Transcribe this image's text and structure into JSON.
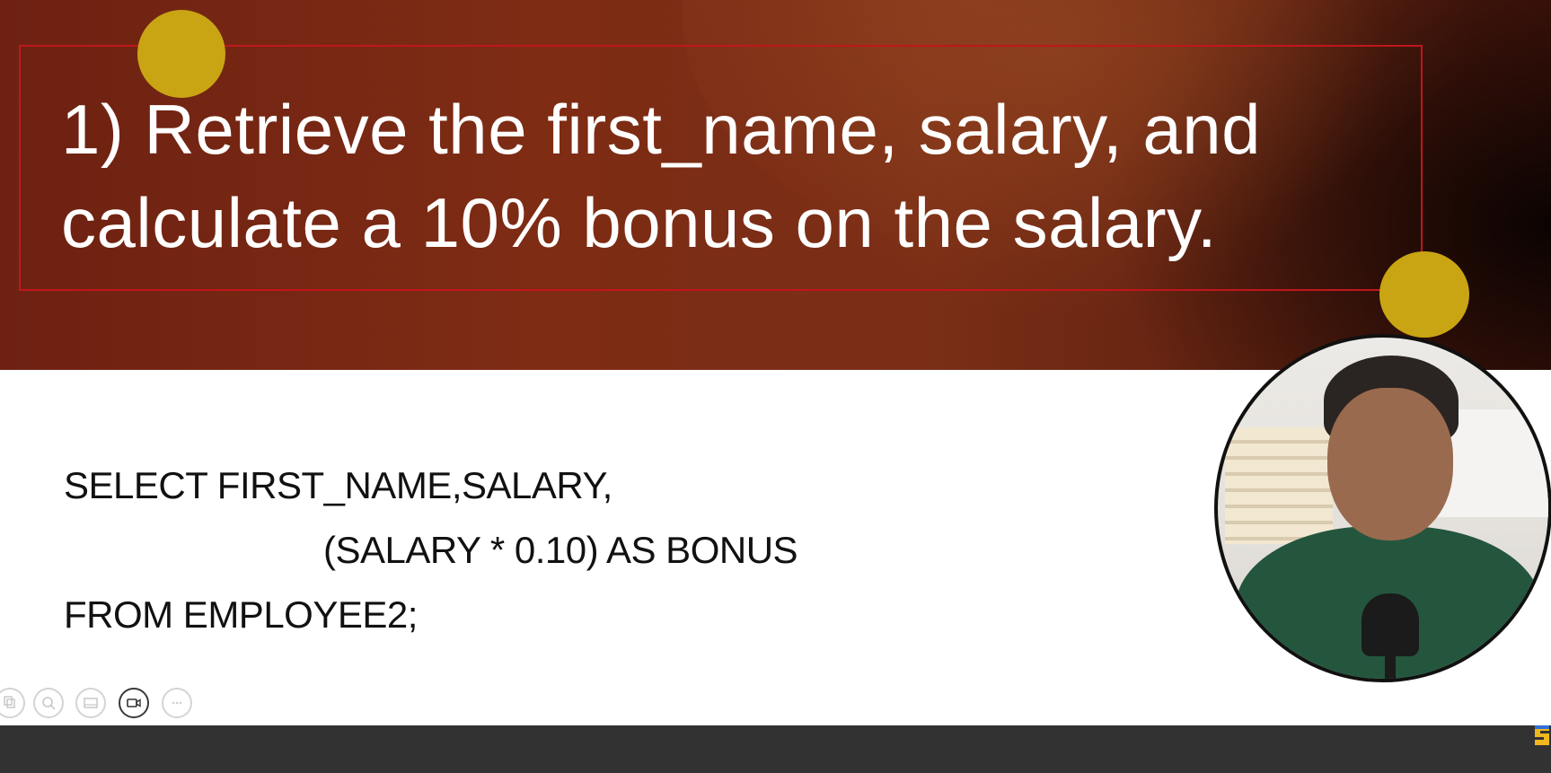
{
  "slide": {
    "title_lines": [
      "1) Retrieve the first_name, salary, and",
      "calculate a 10% bonus on the salary."
    ],
    "code_lines": [
      "SELECT FIRST_NAME,SALARY,",
      "(SALARY * 0.10) AS BONUS",
      "FROM EMPLOYEE2;"
    ]
  },
  "toolbar": {
    "items": [
      {
        "icon": "copy-icon"
      },
      {
        "icon": "zoom-icon"
      },
      {
        "icon": "slides-icon"
      },
      {
        "icon": "video-icon"
      },
      {
        "icon": "more-icon"
      }
    ]
  },
  "colors": {
    "banner_red": "#7e2c14",
    "frame_red": "#c0161c",
    "dot_yellow": "#c9a514",
    "bottom_bar": "#323232"
  }
}
